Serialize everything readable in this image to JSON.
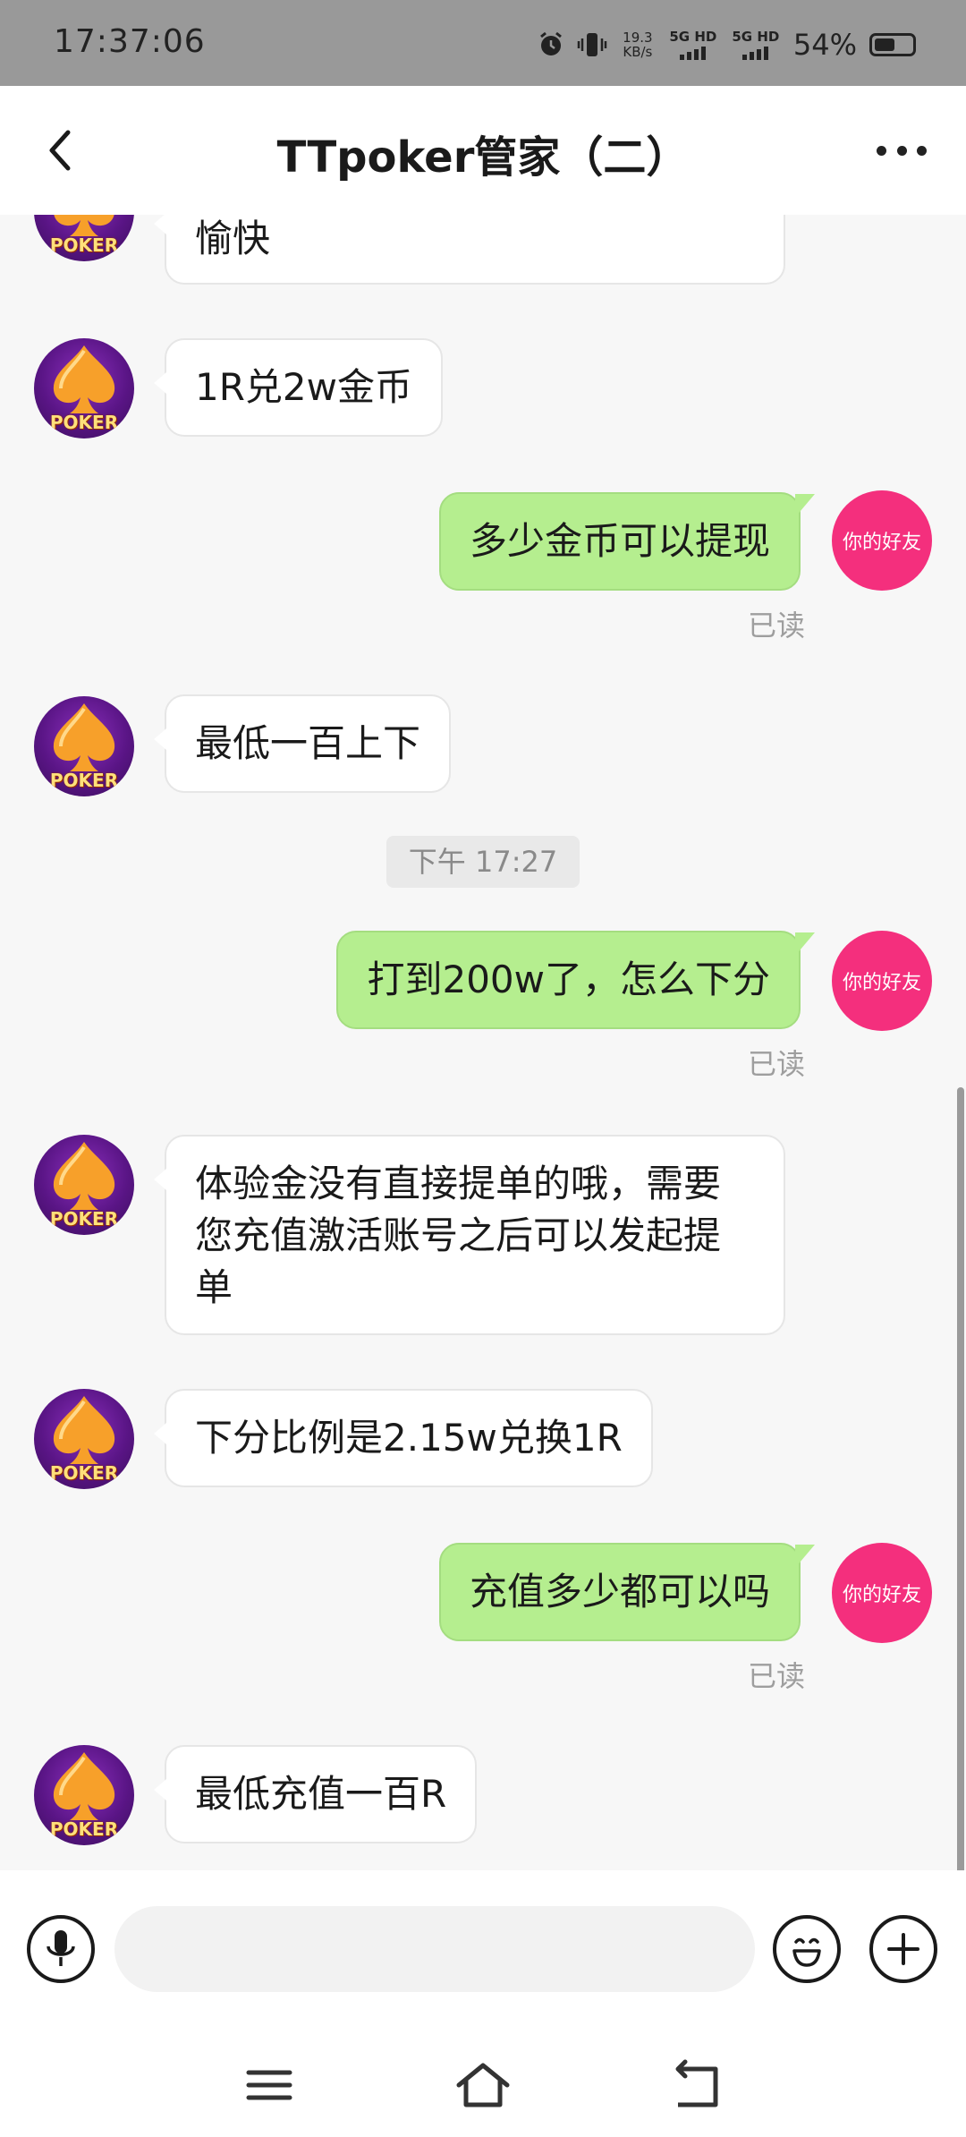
{
  "status_bar": {
    "time": "17:37:06",
    "net_speed_value": "19.3",
    "net_speed_unit": "KB/s",
    "sim1_label": "5G HD",
    "sim2_label": "5G HD",
    "battery_percent": "54%",
    "battery_level": 0.54,
    "icons": [
      "alarm-icon",
      "vibrate-icon"
    ]
  },
  "header": {
    "title": "TTpoker管家（二）",
    "back_icon": "chevron-left-icon",
    "more_icon": "more-dots-icon"
  },
  "chat": {
    "messages": [
      {
        "side": "left",
        "text": "愉快",
        "avatar_text": "POKER"
      },
      {
        "side": "left",
        "text": "1R兑2w金币",
        "avatar_text": "POKER"
      },
      {
        "side": "right",
        "text": "多少金币可以提现",
        "avatar_text": "你的好友",
        "status": "已读"
      },
      {
        "side": "left",
        "text": "最低一百上下",
        "avatar_text": "POKER"
      },
      {
        "side": "time",
        "text": "下午 17:27"
      },
      {
        "side": "right",
        "text": "打到200w了，怎么下分",
        "avatar_text": "你的好友",
        "status": "已读"
      },
      {
        "side": "left",
        "text": "体验金没有直接提单的哦，需要您充值激活账号之后可以发起提单",
        "avatar_text": "POKER"
      },
      {
        "side": "left",
        "text": "下分比例是2.15w兑换1R",
        "avatar_text": "POKER"
      },
      {
        "side": "right",
        "text": "充值多少都可以吗",
        "avatar_text": "你的好友",
        "status": "已读"
      },
      {
        "side": "left",
        "text": "最低充值一百R",
        "avatar_text": "POKER"
      }
    ]
  },
  "input_bar": {
    "value": "",
    "placeholder": "",
    "voice_icon": "microphone-icon",
    "emoji_icon": "emoji-icon",
    "plus_icon": "plus-icon"
  },
  "nav_bar": {
    "icons": [
      "menu-icon",
      "home-icon",
      "back-nav-icon"
    ]
  },
  "colors": {
    "status_bar": "#999999",
    "outgoing_bubble": "#b5ee8f",
    "friend_avatar": "#f42f7d",
    "poker_avatar": "#5a1586"
  }
}
